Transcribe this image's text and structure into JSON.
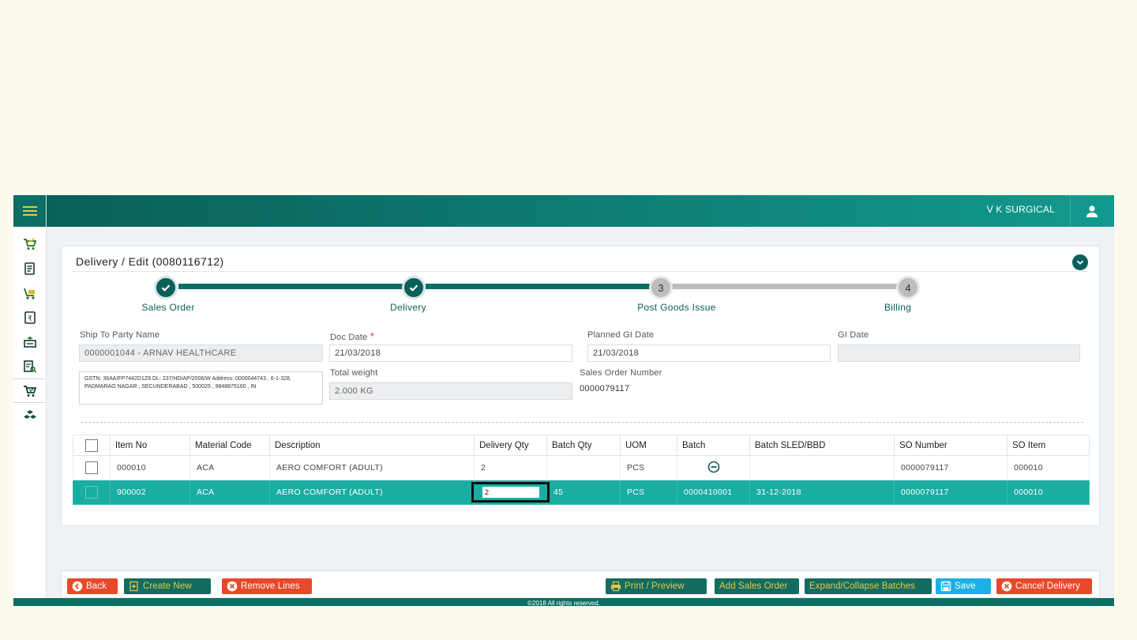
{
  "header": {
    "company": "V K SURGICAL"
  },
  "page": {
    "title": "Delivery / Edit (0080116712)"
  },
  "steps": [
    {
      "label": "Sales Order",
      "status": "done"
    },
    {
      "label": "Delivery",
      "status": "done"
    },
    {
      "label": "Post Goods Issue",
      "status": "pending",
      "number": "3"
    },
    {
      "label": "Billing",
      "status": "pending",
      "number": "4"
    }
  ],
  "form": {
    "ship_to_label": "Ship To Party Name",
    "ship_to_value": "0000001044 - ARNAV HEALTHCARE",
    "address": "GSTN: 36AAIFP7442D1Z8 DL: 237/HD/AP/2006/W Address: 0000044743 , 6-1-328, PADMARAO NAGAR , SECUNDERABAD , 500025 , 9848875160 , IN",
    "doc_date_label": "Doc Date",
    "doc_date_required": "*",
    "doc_date_value": "21/03/2018",
    "planned_gi_label": "Planned GI Date",
    "planned_gi_value": "21/03/2018",
    "gi_date_label": "GI Date",
    "gi_date_value": "",
    "total_weight_label": "Total weight",
    "total_weight_value": "2.000 KG",
    "so_number_label": "Sales Order Number",
    "so_number_value": "0000079117"
  },
  "table": {
    "columns": [
      "Item No",
      "Material Code",
      "Description",
      "Delivery Qty",
      "Batch Qty",
      "UOM",
      "Batch",
      "Batch SLED/BBD",
      "SO Number",
      "SO Item"
    ],
    "rows": [
      {
        "item_no": "000010",
        "material": "ACA",
        "description": "AERO COMFORT (ADULT)",
        "delivery_qty": "2",
        "batch_qty": "",
        "uom": "PCS",
        "batch": "",
        "sled": "",
        "so_number": "0000079117",
        "so_item": "000010"
      },
      {
        "item_no": "900002",
        "material": "ACA",
        "description": "AERO COMFORT (ADULT)",
        "delivery_qty": "2",
        "batch_qty": "45",
        "uom": "PCS",
        "batch": "0000410001",
        "sled": "31-12-2018",
        "so_number": "0000079117",
        "so_item": "000010"
      }
    ]
  },
  "actions": {
    "back": "Back",
    "create_new": "Create New",
    "remove_lines": "Remove Lines",
    "print_preview": "Print / Preview",
    "add_sales_order": "Add Sales Order",
    "expand_collapse": "Expand/Collapse Batches",
    "save": "Save",
    "cancel_delivery": "Cancel Delivery"
  },
  "footer": {
    "copyright": "©2018 All rights reserved."
  },
  "colors": {
    "primary": "#0b5f59",
    "accent": "#1aada2",
    "danger": "#e64a2a",
    "info": "#1cb0e6",
    "gold": "#e8c64a"
  }
}
